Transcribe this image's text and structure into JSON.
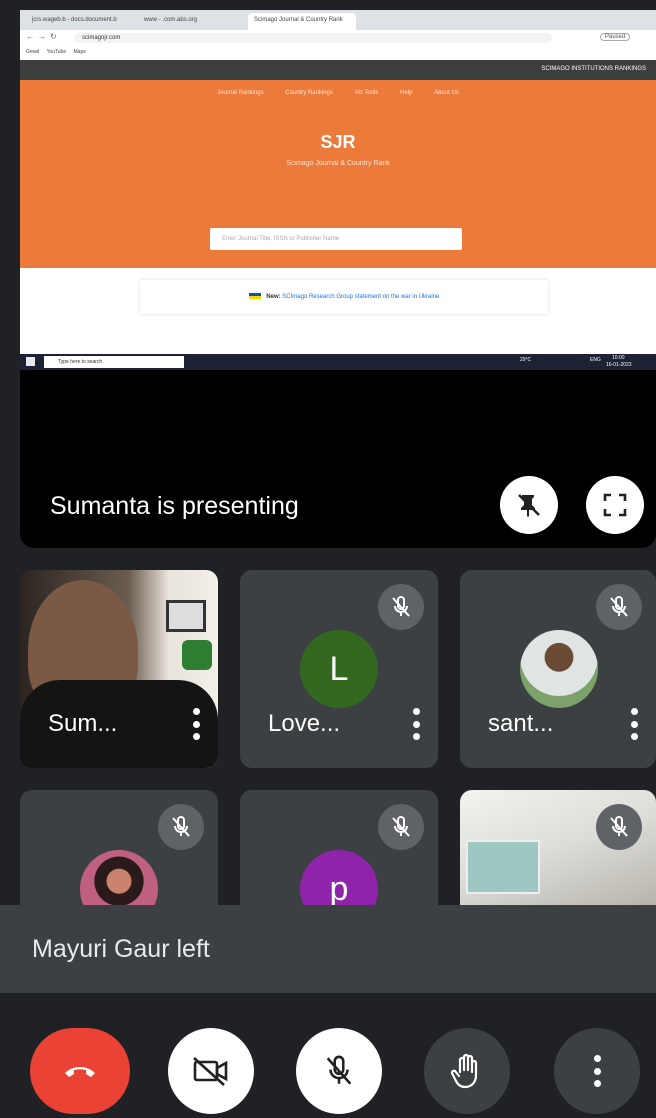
{
  "browser": {
    "tabs": [
      "jcrs.wageb.b - docs.document.b",
      "www - .com.abs.org",
      "Scimago Journal & Country Rank"
    ],
    "url": "scimagojr.com",
    "bookmarks": [
      "Gmail",
      "YouTube",
      "Maps"
    ],
    "profile_label": "Paused"
  },
  "sjr": {
    "top_right": "SCIMAGO INSTITUTIONS RANKINGS",
    "nav": [
      "Journal Rankings",
      "Country Rankings",
      "Viz Tools",
      "Help",
      "About Us"
    ],
    "title": "SJR",
    "subtitle": "Scimago Journal & Country Rank",
    "search_placeholder": "Enter Journal Title, ISSN or Publisher Name",
    "news_prefix": "New:",
    "news_link": "SCImago Research Group statement on the war in Ukraine"
  },
  "taskbar": {
    "search_placeholder": "Type here to search",
    "weather": "29°C",
    "lang": "ENG",
    "time": "10:00",
    "date": "16-01-2023"
  },
  "meet": {
    "presenting_text": "Sumanta is presenting",
    "participants": [
      {
        "name": "Sum...",
        "type": "video"
      },
      {
        "name": "Love...",
        "initial": "L",
        "color": "#33691e"
      },
      {
        "name": "sant...",
        "type": "photo"
      },
      {
        "name": "",
        "type": "photo"
      },
      {
        "name": "",
        "initial": "p",
        "color": "#8e24aa"
      },
      {
        "name": "",
        "type": "video"
      }
    ],
    "toast": "Mayuri Gaur left",
    "colors": {
      "end_call": "#ea4335",
      "background": "#202124",
      "tile": "#3c4043"
    }
  }
}
